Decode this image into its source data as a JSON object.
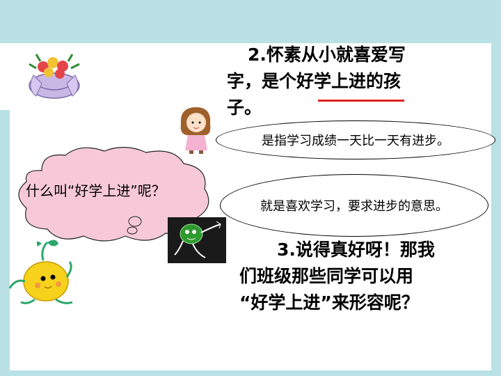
{
  "question_2": {
    "line1": "2.怀素从小就喜爱写",
    "line2": "字，是个好学上进的孩",
    "line3": "子。"
  },
  "answer_1": "是指学习成绩一天比一天有进步。",
  "answer_2": "就是喜欢学习，要求进步的意思。",
  "cloud_question": "什么叫“好学上进”呢？",
  "question_3": {
    "line1": "3.说得真好呀！那我",
    "line2": "们班级那些同学可以用",
    "line3": "“好学上进”来形容呢？"
  },
  "colors": {
    "background": "#b9e1e6",
    "underline": "#e32222",
    "cloud_fill": "#f7c9d8"
  }
}
